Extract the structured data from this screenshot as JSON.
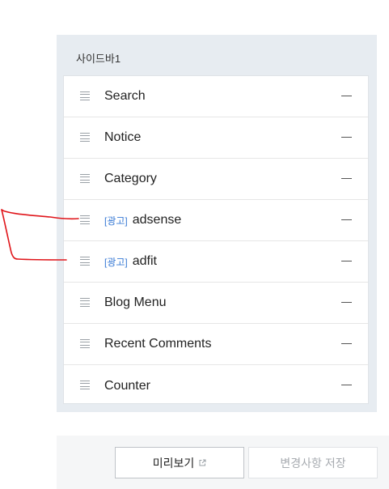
{
  "panel": {
    "title": "사이드바1",
    "items": [
      {
        "label": "Search",
        "badge": ""
      },
      {
        "label": "Notice",
        "badge": ""
      },
      {
        "label": "Category",
        "badge": ""
      },
      {
        "label": "adsense",
        "badge": "[광고]"
      },
      {
        "label": "adfit",
        "badge": "[광고]"
      },
      {
        "label": "Blog Menu",
        "badge": ""
      },
      {
        "label": "Recent Comments",
        "badge": ""
      },
      {
        "label": "Counter",
        "badge": ""
      }
    ]
  },
  "footer": {
    "preview_label": "미리보기",
    "save_label": "변경사항 저장"
  },
  "colors": {
    "panel_bg": "#e7ecf1",
    "badge": "#3a7bd5",
    "annotation": "#e0161b"
  }
}
